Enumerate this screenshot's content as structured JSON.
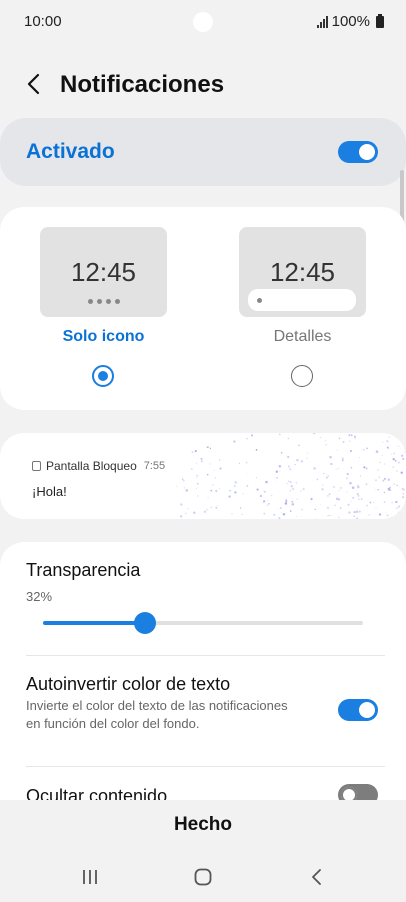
{
  "status_bar": {
    "time": "10:00",
    "battery": "100%"
  },
  "header": {
    "title": "Notificaciones"
  },
  "master": {
    "label": "Activado",
    "enabled": true
  },
  "style_options": {
    "icon_only": {
      "preview_time": "12:45",
      "label": "Solo icono",
      "selected": true
    },
    "details": {
      "preview_time": "12:45",
      "label": "Detalles",
      "selected": false
    }
  },
  "preview_notification": {
    "app": "Pantalla Bloqueo",
    "time": "7:55",
    "message": "¡Hola!"
  },
  "settings": {
    "transparency": {
      "title": "Transparencia",
      "value_text": "32%",
      "value": 0.32
    },
    "auto_invert": {
      "title": "Autoinvertir color de texto",
      "description": "Invierte el color del texto de las notificaciones en función del color del fondo.",
      "enabled": true
    },
    "hide_content": {
      "title": "Ocultar contenido",
      "enabled": false
    }
  },
  "footer": {
    "done_label": "Hecho"
  },
  "colors": {
    "accent": "#1a7fe0",
    "title_blue": "#0a72d6"
  }
}
